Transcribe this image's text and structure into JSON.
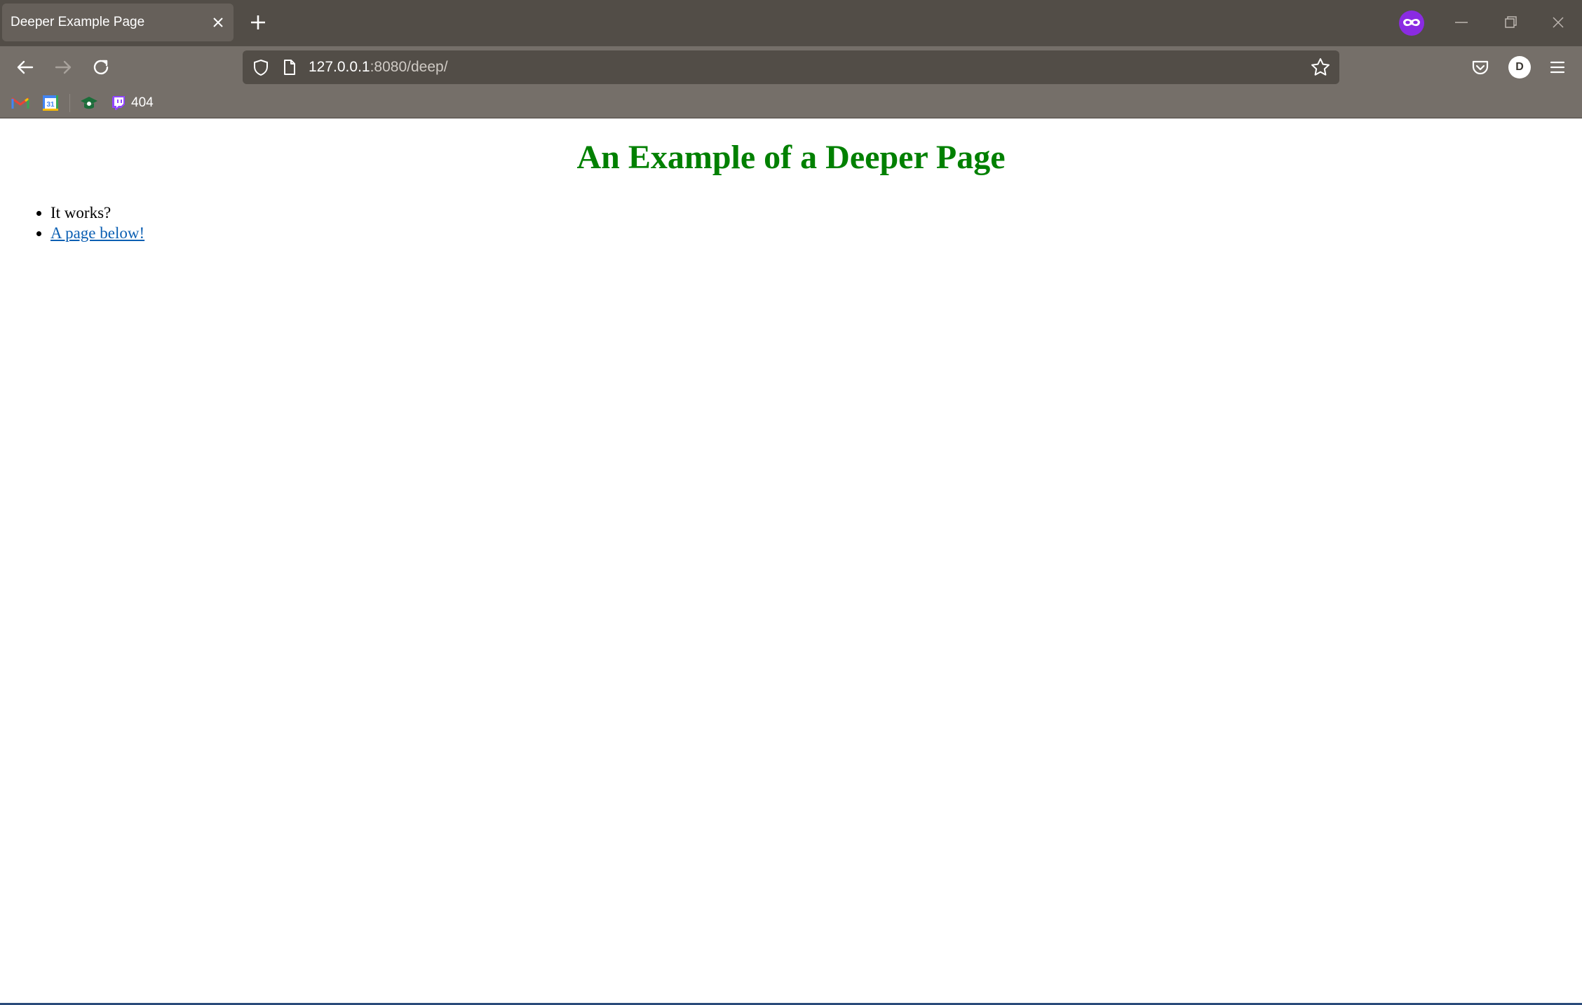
{
  "browser": {
    "tab": {
      "title": "Deeper Example Page"
    },
    "url": {
      "host": "127.0.0.1",
      "rest": ":8080/deep/"
    },
    "account_initial": "D",
    "bookmarks": [
      {
        "icon": "gmail-icon",
        "label": ""
      },
      {
        "icon": "calendar-icon",
        "label": ""
      },
      {
        "icon": "graduation-cap-icon",
        "label": ""
      },
      {
        "icon": "twitch-icon",
        "label": "404"
      }
    ]
  },
  "page": {
    "title": "An Example of a Deeper Page",
    "items": [
      {
        "text": "It works?",
        "link": false
      },
      {
        "text": "A page below!",
        "link": true
      }
    ]
  },
  "colors": {
    "title": "#008000",
    "link": "#0b5fb3",
    "tabstrip": "#524d47",
    "toolbar": "#756f69"
  }
}
